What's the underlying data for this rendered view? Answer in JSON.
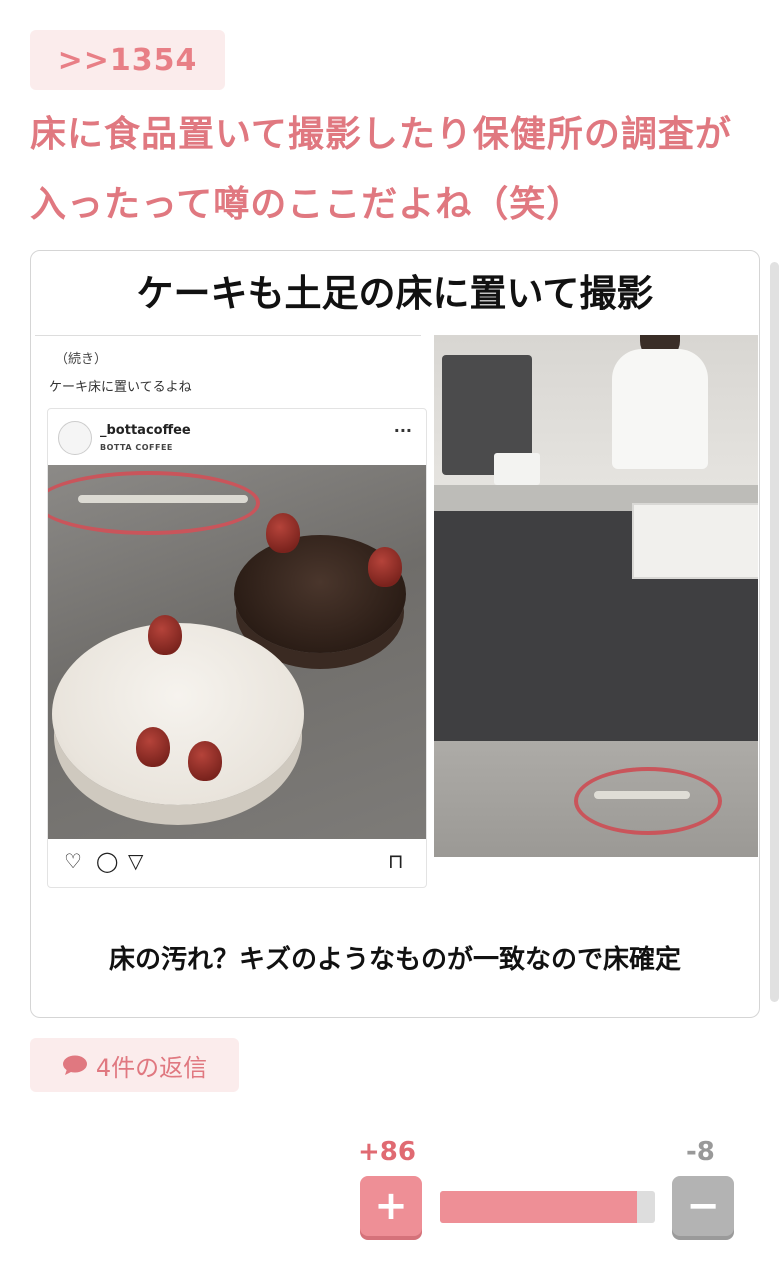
{
  "post": {
    "reference": ">>1354",
    "text": "床に食品置いて撮影したり保健所の調査が入ったって噂のここだよね（笑）"
  },
  "image": {
    "title": "ケーキも土足の床に置いて撮影",
    "caption": "床の汚れ？キズのようなものが一致なので床確定",
    "quote_label": "（続き）",
    "quote_text": "ケーキ床に置いてるよね",
    "instagram": {
      "username": "_bottacoffee",
      "subtitle": "BOTTA COFFEE",
      "more_icon": "more-dots-icon",
      "actions": [
        "heart-icon",
        "comment-icon",
        "share-icon",
        "bookmark-icon"
      ]
    }
  },
  "replies": {
    "label": "4件の返信",
    "icon": "speech-bubble-icon"
  },
  "votes": {
    "plus_label": "+86",
    "minus_label": "-8",
    "plus_icon": "plus-icon",
    "minus_icon": "minus-icon",
    "plus_symbol": "+",
    "minus_symbol": "−",
    "ratio": 0.915
  },
  "colors": {
    "accent": "#e07880",
    "accent_light": "#fbecec",
    "vote_plus": "#ee8f96",
    "vote_minus": "#b3b3b3"
  }
}
